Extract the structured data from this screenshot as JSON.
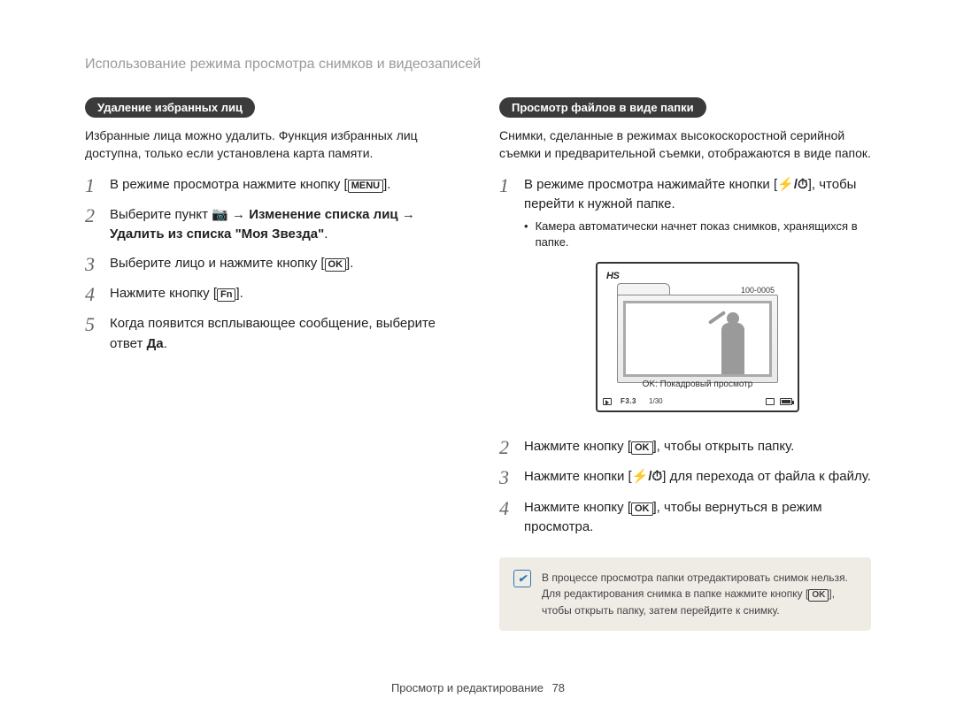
{
  "breadcrumb": "Использование режима просмотра снимков и видеозаписей",
  "left": {
    "tag": "Удаление избранных лиц",
    "intro": "Избранные лица можно удалить. Функция избранных лиц доступна, только если установлена карта памяти.",
    "steps": {
      "s1_a": "В режиме просмотра нажмите кнопку [",
      "s1_key": "MENU",
      "s1_b": "].",
      "s2_a": "Выберите пункт ",
      "s2_icon": "📷",
      "s2_arrow": " → ",
      "s2_bold1": "Изменение списка лиц",
      "s2_bold2": "Удалить из списка \"Моя Звезда\"",
      "s2_dot": ".",
      "s3_a": "Выберите лицо и нажмите кнопку [",
      "s3_key": "OK",
      "s3_b": "].",
      "s4_a": "Нажмите кнопку [",
      "s4_key": "Fn",
      "s4_b": "].",
      "s5_a": "Когда появится всплывающее сообщение, выберите ответ ",
      "s5_bold": "Да",
      "s5_b": "."
    }
  },
  "right": {
    "tag": "Просмотр файлов в виде папки",
    "intro": "Снимки, сделанные в режимах высокоскоростной серийной съемки и предварительной съемки, отображаются в виде папок.",
    "steps": {
      "s1_a": "В режиме просмотра нажимайте кнопки [",
      "s1_icons": "⚡/⏱",
      "s1_b": "], чтобы перейти к нужной папке.",
      "s1_bullet": "Камера автоматически начнет показ снимков, хранящихся в папке.",
      "s2_a": "Нажмите кнопку [",
      "s2_key": "OK",
      "s2_b": "], чтобы открыть папку.",
      "s3_a": "Нажмите кнопки [",
      "s3_icons": "⚡/⏱",
      "s3_b": "] для перехода от файла к файлу.",
      "s4_a": "Нажмите кнопку [",
      "s4_key": "OK",
      "s4_b": "], чтобы вернуться в режим просмотра."
    },
    "figure": {
      "hs": "HS",
      "folder_num": "100-0005",
      "ok_line": "OK: Покадровый просмотр",
      "f33": "F3.3",
      "idx": "1/30"
    },
    "note_a": "В процессе просмотра папки отредактировать снимок нельзя. Для редактирования снимка в папке нажмите кнопку [",
    "note_key": "OK",
    "note_b": "], чтобы открыть папку, затем перейдите к снимку."
  },
  "footer": {
    "section": "Просмотр и редактирование",
    "page": "78"
  }
}
